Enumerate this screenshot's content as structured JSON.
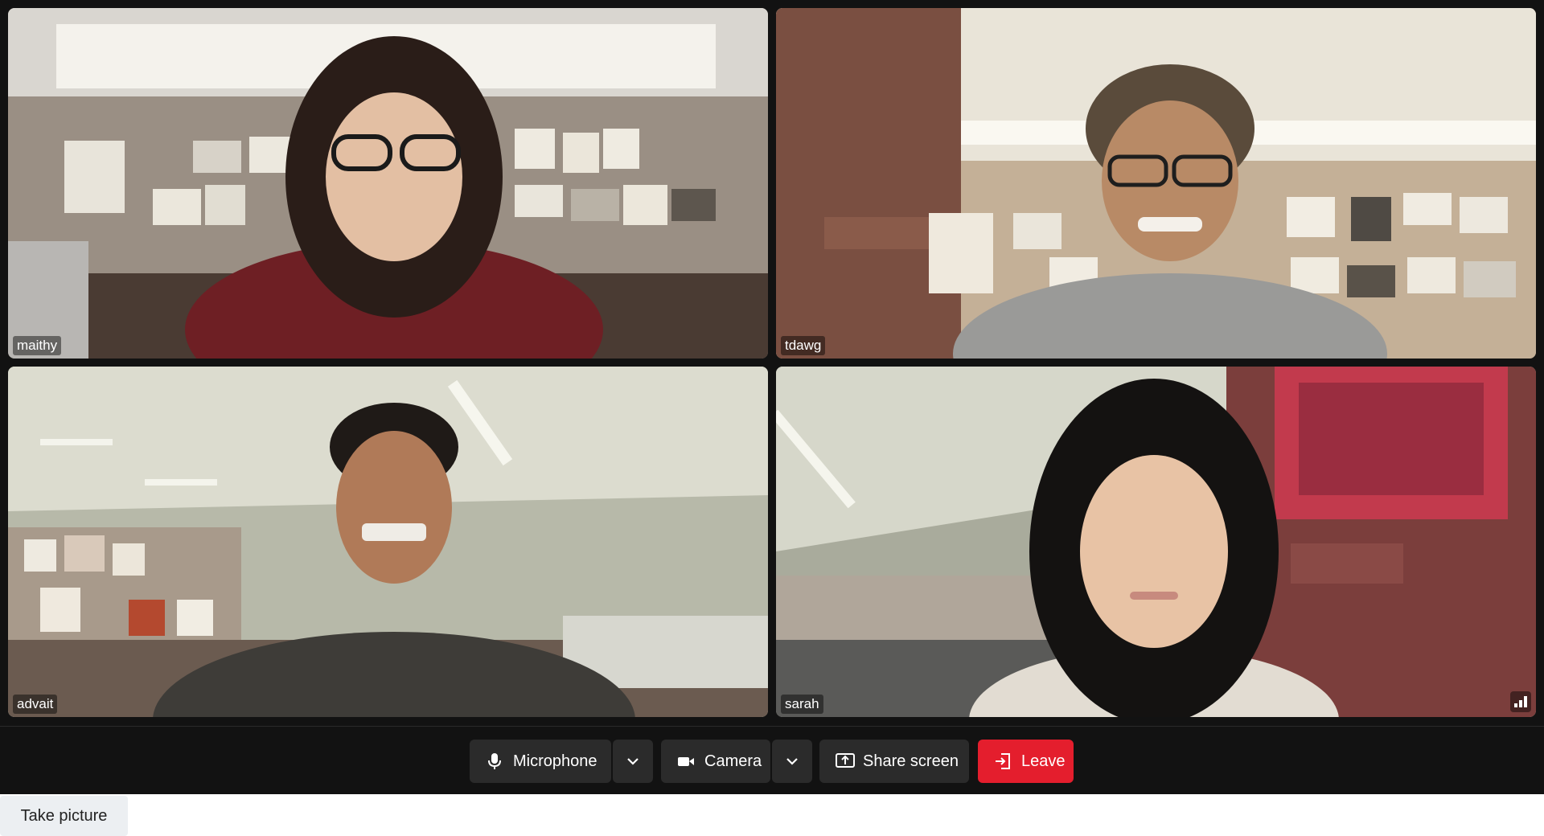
{
  "participants": [
    {
      "name": "maithy"
    },
    {
      "name": "tdawg"
    },
    {
      "name": "advait"
    },
    {
      "name": "sarah"
    }
  ],
  "controls": {
    "microphone_label": "Microphone",
    "camera_label": "Camera",
    "share_screen_label": "Share screen",
    "leave_label": "Leave"
  },
  "take_picture_label": "Take picture",
  "icons": {
    "microphone": "microphone-icon",
    "camera": "camera-icon",
    "share": "share-screen-icon",
    "leave": "leave-icon",
    "caret": "chevron-down-icon",
    "signal": "signal-strength-icon"
  },
  "colors": {
    "background": "#121212",
    "control": "#2b2b2b",
    "leave": "#e41e2d"
  }
}
